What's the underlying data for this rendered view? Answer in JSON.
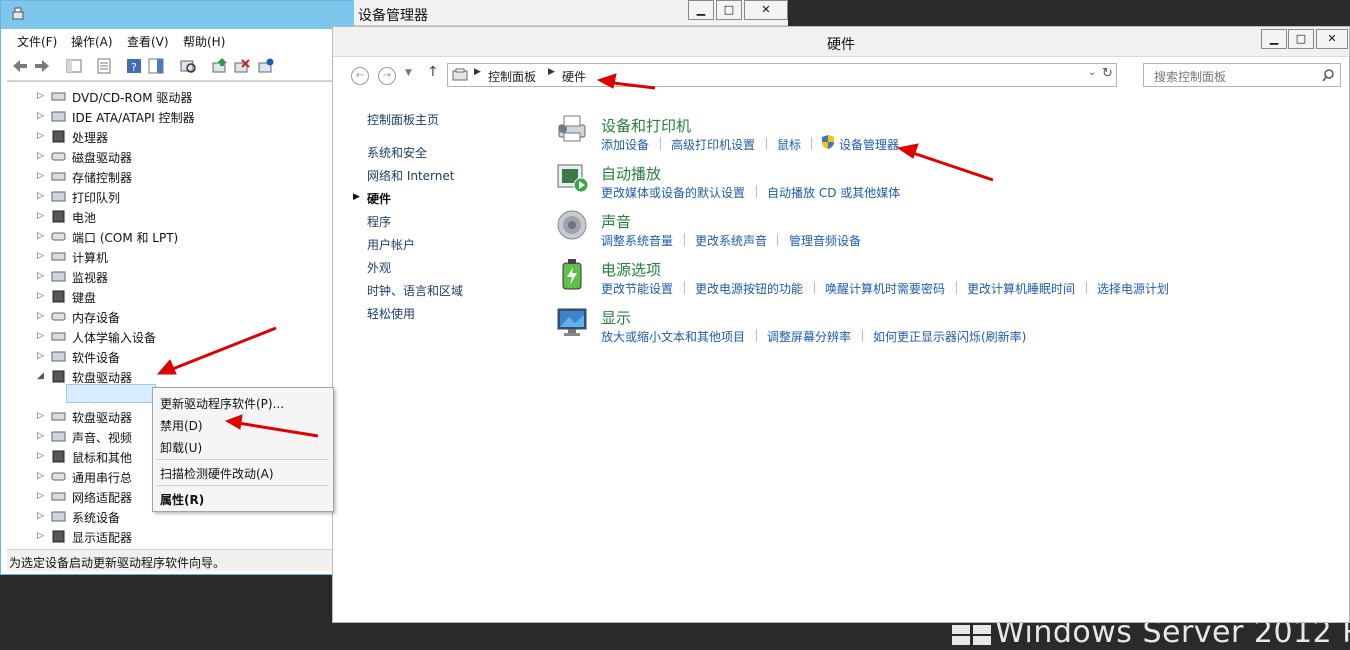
{
  "device_manager": {
    "title": "设备管理器",
    "menu": [
      "文件(F)",
      "操作(A)",
      "查看(V)",
      "帮助(H)"
    ],
    "tree": [
      {
        "label": "DVD/CD-ROM 驱动器",
        "expanded": false
      },
      {
        "label": "IDE ATA/ATAPI 控制器",
        "expanded": false
      },
      {
        "label": "处理器",
        "expanded": false
      },
      {
        "label": "磁盘驱动器",
        "expanded": false
      },
      {
        "label": "存储控制器",
        "expanded": false
      },
      {
        "label": "打印队列",
        "expanded": false
      },
      {
        "label": "电池",
        "expanded": false
      },
      {
        "label": "端口 (COM 和 LPT)",
        "expanded": false
      },
      {
        "label": "计算机",
        "expanded": false
      },
      {
        "label": "监视器",
        "expanded": false
      },
      {
        "label": "键盘",
        "expanded": false
      },
      {
        "label": "内存设备",
        "expanded": false
      },
      {
        "label": "人体学输入设备",
        "expanded": false
      },
      {
        "label": "软件设备",
        "expanded": false
      },
      {
        "label": "软盘驱动器",
        "expanded": true
      },
      {
        "label": "软盘驱",
        "expanded": false
      },
      {
        "label": "软盘驱动器",
        "expanded": false
      },
      {
        "label": "声音、视频",
        "expanded": false
      },
      {
        "label": "鼠标和其他",
        "expanded": false
      },
      {
        "label": "通用串行总",
        "expanded": false
      },
      {
        "label": "网络适配器",
        "expanded": false
      },
      {
        "label": "系统设备",
        "expanded": false
      },
      {
        "label": "显示适配器",
        "expanded": false
      }
    ],
    "status": "为选定设备启动更新驱动程序软件向导。"
  },
  "context_menu": {
    "update": "更新驱动程序软件(P)...",
    "disable": "禁用(D)",
    "uninstall": "卸载(U)",
    "scan": "扫描检测硬件改动(A)",
    "properties": "属性(R)"
  },
  "control_panel": {
    "title": "硬件",
    "breadcrumb": [
      "控制面板",
      "硬件"
    ],
    "search_placeholder": "搜索控制面板",
    "left_nav": {
      "home": "控制面板主页",
      "items": [
        "系统和安全",
        "网络和 Internet",
        "硬件",
        "程序",
        "用户帐户",
        "外观",
        "时钟、语言和区域",
        "轻松使用"
      ],
      "active": "硬件"
    },
    "categories": [
      {
        "title": "设备和打印机",
        "icon": "printer-icon",
        "links": [
          "添加设备",
          "高级打印机设置",
          "鼠标",
          "设备管理器"
        ]
      },
      {
        "title": "自动播放",
        "icon": "autoplay-icon",
        "links": [
          "更改媒体或设备的默认设置",
          "自动播放 CD 或其他媒体"
        ]
      },
      {
        "title": "声音",
        "icon": "speaker-icon",
        "links": [
          "调整系统音量",
          "更改系统声音",
          "管理音频设备"
        ]
      },
      {
        "title": "电源选项",
        "icon": "battery-icon",
        "links": [
          "更改节能设置",
          "更改电源按钮的功能",
          "唤醒计算机时需要密码",
          "更改计算机睡眠时间",
          "选择电源计划"
        ]
      },
      {
        "title": "显示",
        "icon": "monitor-icon",
        "links": [
          "放大或缩小文本和其他项目",
          "调整屏幕分辨率",
          "如何更正显示器闪烁(刷新率)"
        ]
      }
    ]
  },
  "desktop": {
    "brand": "Windows Server 2012 R2"
  },
  "colors": {
    "category_green": "#26813b",
    "link_blue": "#1f5bb0",
    "annotation_red": "#e00000",
    "dm_title_blue": "#7fc6ec"
  }
}
